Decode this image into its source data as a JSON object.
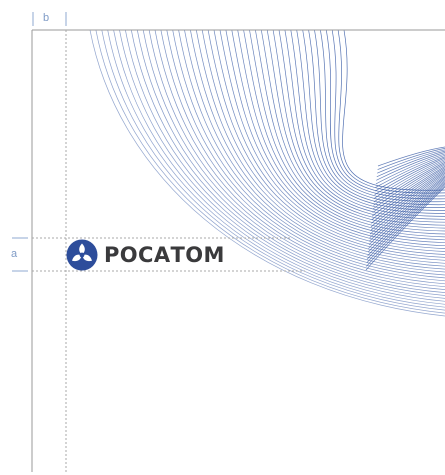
{
  "guides": {
    "label_b": "b",
    "label_a": "a"
  },
  "logo": {
    "wordmark": "РОСАТОМ",
    "emblem_icon": "rosatom-atom-emblem-icon"
  },
  "colors": {
    "wave_lines": "#3d5fa8",
    "guide_blue": "#8fa8d2",
    "guide_gray": "#a8a8a8",
    "frame": "#9a9a9a",
    "emblem": "#2d4d9b",
    "wordmark": "#3a3a3c"
  }
}
